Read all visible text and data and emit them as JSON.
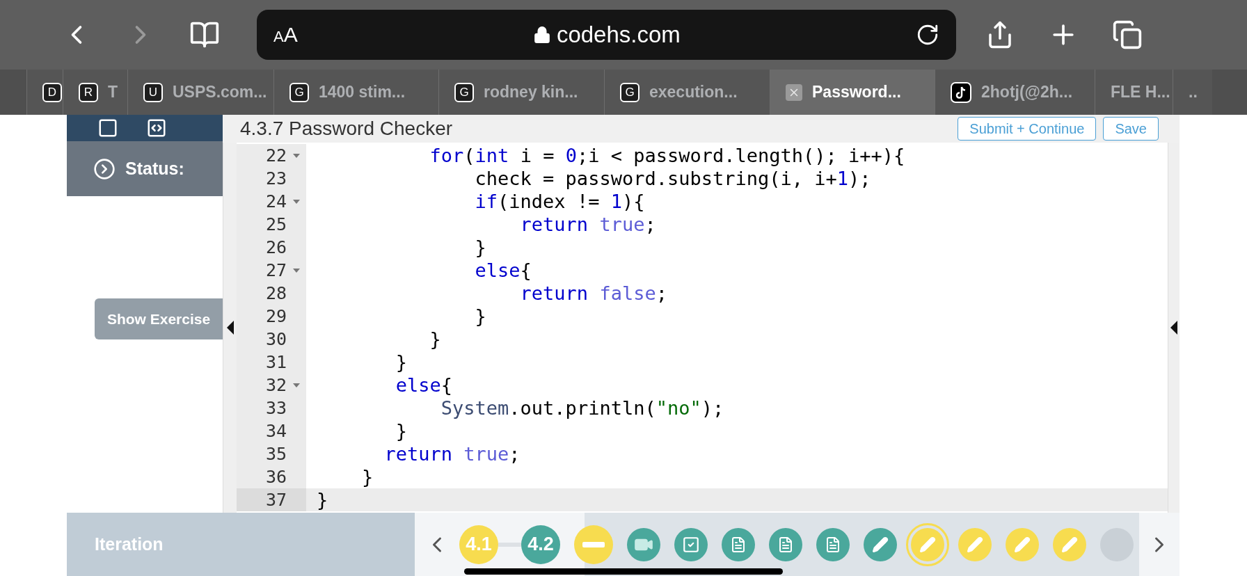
{
  "browser": {
    "address": {
      "text_size_button": "AA",
      "url": "codehs.com"
    },
    "back_enabled": true,
    "forward_enabled": false
  },
  "tabs": [
    {
      "kind": "letter",
      "badge": "D",
      "selected": false
    },
    {
      "kind": "letter",
      "badge": "R",
      "title": "T",
      "selected": false
    },
    {
      "kind": "letter",
      "badge": "U",
      "title": "USPS.com...",
      "selected": false
    },
    {
      "kind": "letter",
      "badge": "G",
      "title": "1400 stim...",
      "selected": false
    },
    {
      "kind": "letter",
      "badge": "G",
      "title": "rodney kin...",
      "selected": false
    },
    {
      "kind": "letter",
      "badge": "G",
      "title": "execution...",
      "selected": false
    },
    {
      "kind": "close",
      "title": "Password...",
      "selected": true
    },
    {
      "kind": "tiktok",
      "title": "2hotj(@2h...",
      "selected": false
    },
    {
      "kind": "plain",
      "title": "FLE H...",
      "selected": false
    },
    {
      "kind": "plain",
      "title": "..",
      "selected": false
    }
  ],
  "sidebar": {
    "status_label": "Status:",
    "show_exercise_button": "Show Exercise"
  },
  "editor": {
    "title": "4.3.7 Password Checker",
    "buttons": [
      "Submit + Continue",
      "Save"
    ],
    "lines": [
      {
        "number": "22",
        "fold": true,
        "current": false,
        "tokens": [
          {
            "kind": "kw",
            "text": "          for"
          },
          {
            "kind": "plain",
            "text": "("
          },
          {
            "kind": "kw",
            "text": "int"
          },
          {
            "kind": "plain",
            "text": " i = "
          },
          {
            "kind": "num",
            "text": "0"
          },
          {
            "kind": "plain",
            "text": ";i < password.length(); i++){"
          }
        ]
      },
      {
        "number": "23",
        "fold": false,
        "current": false,
        "tokens": [
          {
            "kind": "plain",
            "text": "              check = password.substring(i, i+"
          },
          {
            "kind": "num",
            "text": "1"
          },
          {
            "kind": "plain",
            "text": ");"
          }
        ]
      },
      {
        "number": "24",
        "fold": true,
        "current": false,
        "tokens": [
          {
            "kind": "kw",
            "text": "              if"
          },
          {
            "kind": "plain",
            "text": "(index != "
          },
          {
            "kind": "num",
            "text": "1"
          },
          {
            "kind": "plain",
            "text": "){"
          }
        ]
      },
      {
        "number": "25",
        "fold": false,
        "current": false,
        "tokens": [
          {
            "kind": "kw",
            "text": "                  return"
          },
          {
            "kind": "const",
            "text": " true"
          },
          {
            "kind": "plain",
            "text": ";"
          }
        ]
      },
      {
        "number": "26",
        "fold": false,
        "current": false,
        "tokens": [
          {
            "kind": "plain",
            "text": "              }"
          }
        ]
      },
      {
        "number": "27",
        "fold": true,
        "current": false,
        "tokens": [
          {
            "kind": "kw",
            "text": "              else"
          },
          {
            "kind": "plain",
            "text": "{"
          }
        ]
      },
      {
        "number": "28",
        "fold": false,
        "current": false,
        "tokens": [
          {
            "kind": "kw",
            "text": "                  return"
          },
          {
            "kind": "const",
            "text": " false"
          },
          {
            "kind": "plain",
            "text": ";"
          }
        ]
      },
      {
        "number": "29",
        "fold": false,
        "current": false,
        "tokens": [
          {
            "kind": "plain",
            "text": "              }"
          }
        ]
      },
      {
        "number": "30",
        "fold": false,
        "current": false,
        "tokens": [
          {
            "kind": "plain",
            "text": "          }"
          }
        ]
      },
      {
        "number": "31",
        "fold": false,
        "current": false,
        "tokens": [
          {
            "kind": "plain",
            "text": "       }"
          }
        ]
      },
      {
        "number": "32",
        "fold": true,
        "current": false,
        "tokens": [
          {
            "kind": "kw",
            "text": "       else"
          },
          {
            "kind": "plain",
            "text": "{"
          }
        ]
      },
      {
        "number": "33",
        "fold": false,
        "current": false,
        "tokens": [
          {
            "kind": "type",
            "text": "           System"
          },
          {
            "kind": "plain",
            "text": ".out.println("
          },
          {
            "kind": "str",
            "text": "\"no\""
          },
          {
            "kind": "plain",
            "text": ");"
          }
        ]
      },
      {
        "number": "34",
        "fold": false,
        "current": false,
        "tokens": [
          {
            "kind": "plain",
            "text": "       }"
          }
        ]
      },
      {
        "number": "35",
        "fold": false,
        "current": false,
        "tokens": [
          {
            "kind": "kw",
            "text": "      return"
          },
          {
            "kind": "const",
            "text": " true"
          },
          {
            "kind": "plain",
            "text": ";"
          }
        ]
      },
      {
        "number": "36",
        "fold": false,
        "current": false,
        "tokens": [
          {
            "kind": "plain",
            "text": "    }"
          }
        ]
      },
      {
        "number": "37",
        "fold": false,
        "current": true,
        "tokens": [
          {
            "kind": "plain",
            "text": "}"
          }
        ]
      }
    ]
  },
  "bottom_bar": {
    "lesson": "Iteration",
    "items": [
      {
        "kind": "label",
        "text": "4.1",
        "color": "#f7dc4f",
        "selected": false
      },
      {
        "kind": "label",
        "text": "4.2",
        "color": "#4aa89c",
        "selected": false
      },
      {
        "kind": "minus",
        "color": "#f7dc4f",
        "selected": false
      },
      {
        "kind": "video",
        "color": "#4aa89c",
        "selected": false
      },
      {
        "kind": "check",
        "color": "#4aa89c",
        "selected": false
      },
      {
        "kind": "doc",
        "color": "#4aa89c",
        "selected": false
      },
      {
        "kind": "doc",
        "color": "#4aa89c",
        "selected": false
      },
      {
        "kind": "doc",
        "color": "#4aa89c",
        "selected": false
      },
      {
        "kind": "pencil",
        "color": "#4aa89c",
        "selected": false
      },
      {
        "kind": "pencil",
        "color": "#f7dc4f",
        "selected": true
      },
      {
        "kind": "pencil",
        "color": "#f7dc4f",
        "selected": false
      },
      {
        "kind": "pencil",
        "color": "#f7dc4f",
        "selected": false
      },
      {
        "kind": "pencil",
        "color": "#f7dc4f",
        "selected": false
      },
      {
        "kind": "blank",
        "color": "#c9d0d6",
        "selected": false
      }
    ]
  }
}
